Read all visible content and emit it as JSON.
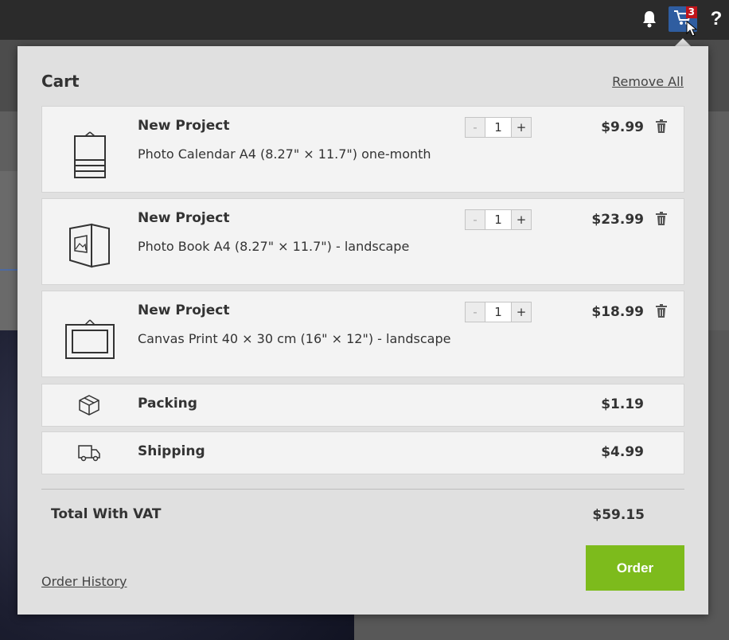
{
  "topbar": {
    "icons": {
      "bell": "bell-icon",
      "cart": "cart-icon",
      "help": "help-icon"
    },
    "cart_badge": "3",
    "help_label": "?"
  },
  "cart": {
    "title": "Cart",
    "remove_all_label": "Remove All",
    "items": [
      {
        "name": "New Project",
        "description": "Photo Calendar A4 (8.27\" × 11.7\") one-month",
        "quantity": "1",
        "price": "$9.99",
        "icon": "calendar-icon"
      },
      {
        "name": "New Project",
        "description": "Photo Book A4 (8.27\" × 11.7\") - landscape",
        "quantity": "1",
        "price": "$23.99",
        "icon": "photo-book-icon"
      },
      {
        "name": "New Project",
        "description": "Canvas Print 40 × 30 cm (16\" × 12\") - landscape",
        "quantity": "1",
        "price": "$18.99",
        "icon": "canvas-print-icon"
      }
    ],
    "stepper": {
      "minus": "-",
      "plus": "+"
    },
    "fees": [
      {
        "name": "Packing",
        "price": "$1.19",
        "icon": "box-icon"
      },
      {
        "name": "Shipping",
        "price": "$4.99",
        "icon": "truck-icon"
      }
    ],
    "total_label": "Total With VAT",
    "total_value": "$59.15",
    "order_label": "Order",
    "order_history_label": "Order History"
  },
  "colors": {
    "accent_green": "#7dbb1c",
    "cart_button": "#2f5da0",
    "badge_red": "#c0141a"
  }
}
